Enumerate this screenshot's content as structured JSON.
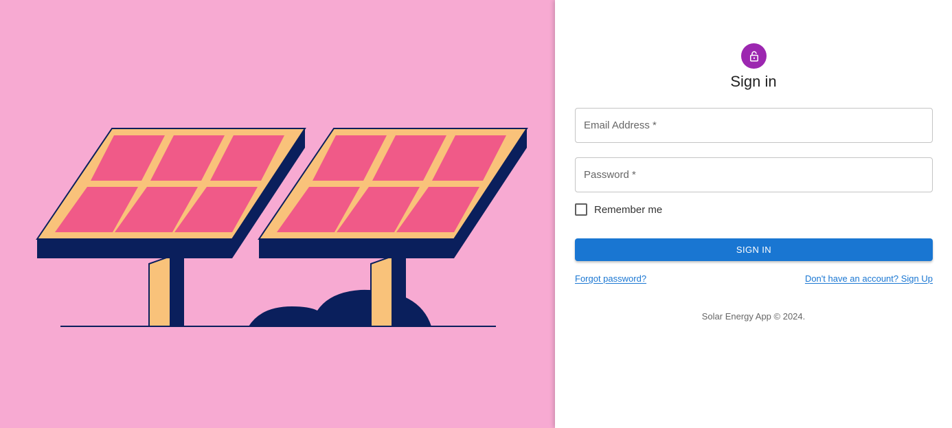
{
  "colors": {
    "hero_bg": "#f7aad2",
    "panel_frame": "#f9c27a",
    "panel_cell": "#f05a88",
    "panel_side": "#0a1f5c",
    "avatar_bg": "#9c27b0",
    "primary": "#1976d2"
  },
  "hero": {
    "illustration": "solar-panels-illustration"
  },
  "form": {
    "avatar_icon": "lock-icon",
    "title": "Sign in",
    "email_placeholder": "Email Address *",
    "password_placeholder": "Password *",
    "remember_label": "Remember me",
    "submit_label": "SIGN IN",
    "forgot_link": "Forgot password?",
    "signup_link": "Don't have an account? Sign Up"
  },
  "footer": {
    "text": "Solar Energy App © 2024."
  }
}
